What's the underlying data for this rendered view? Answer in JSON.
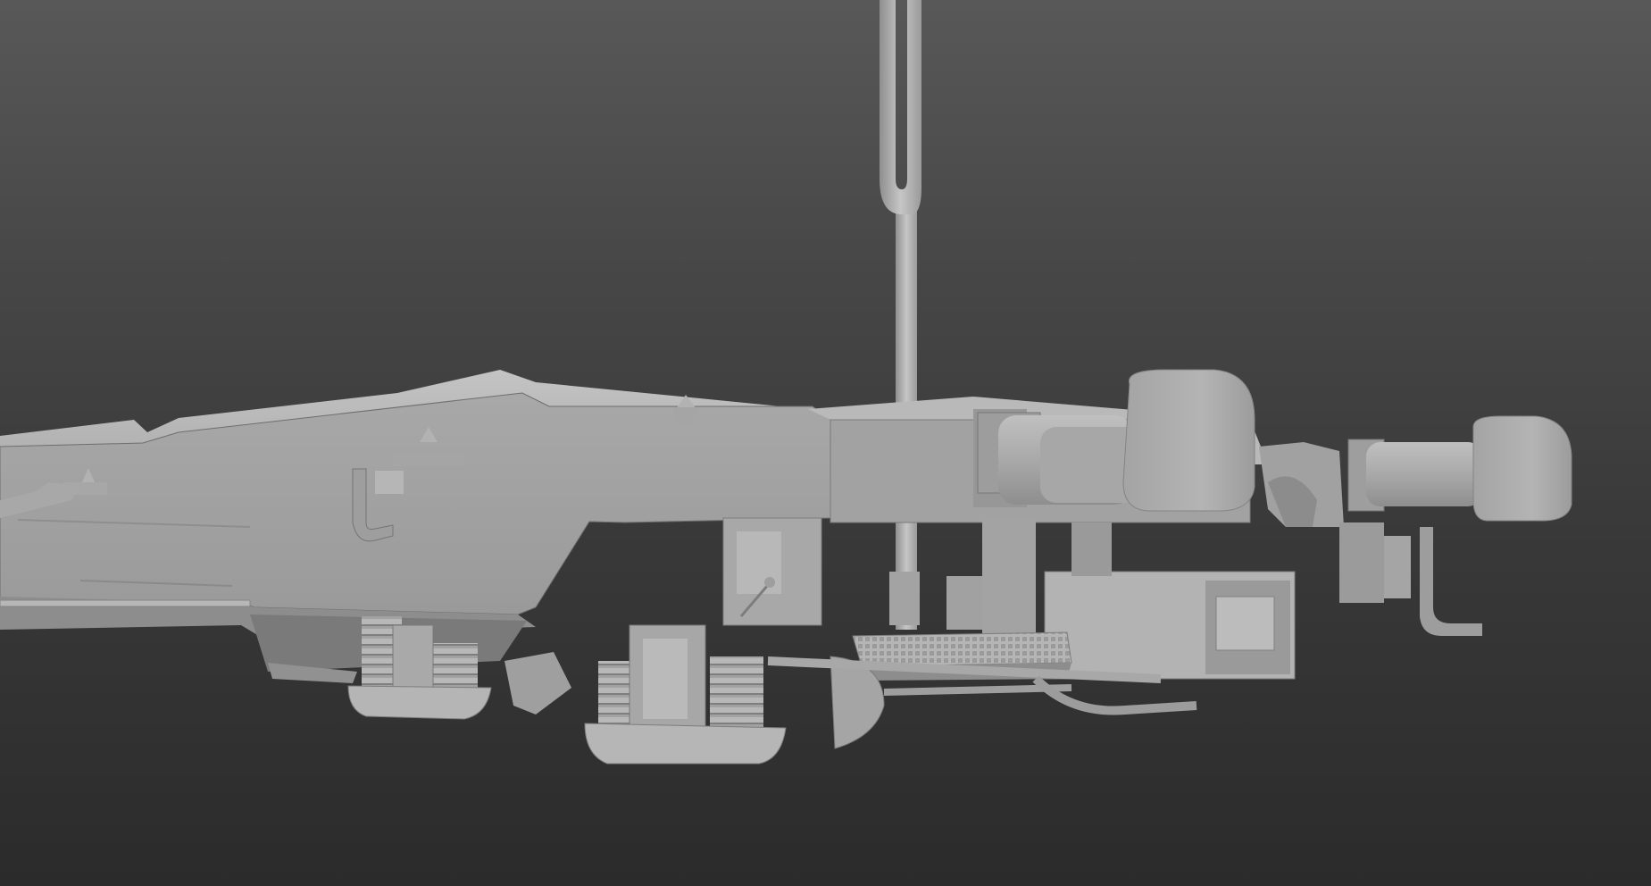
{
  "viewport": {
    "kind": "3d-render-viewport",
    "subject": "railway-wagon-underframe",
    "colors": {
      "background_top": "#585858",
      "background_bottom": "#2b2b2b",
      "model_light": "#bdbdbd",
      "model_mid": "#a6a6a6",
      "model_dark": "#8a8a8a",
      "model_shadow": "#767676",
      "edge": "#6e6e6e"
    }
  }
}
